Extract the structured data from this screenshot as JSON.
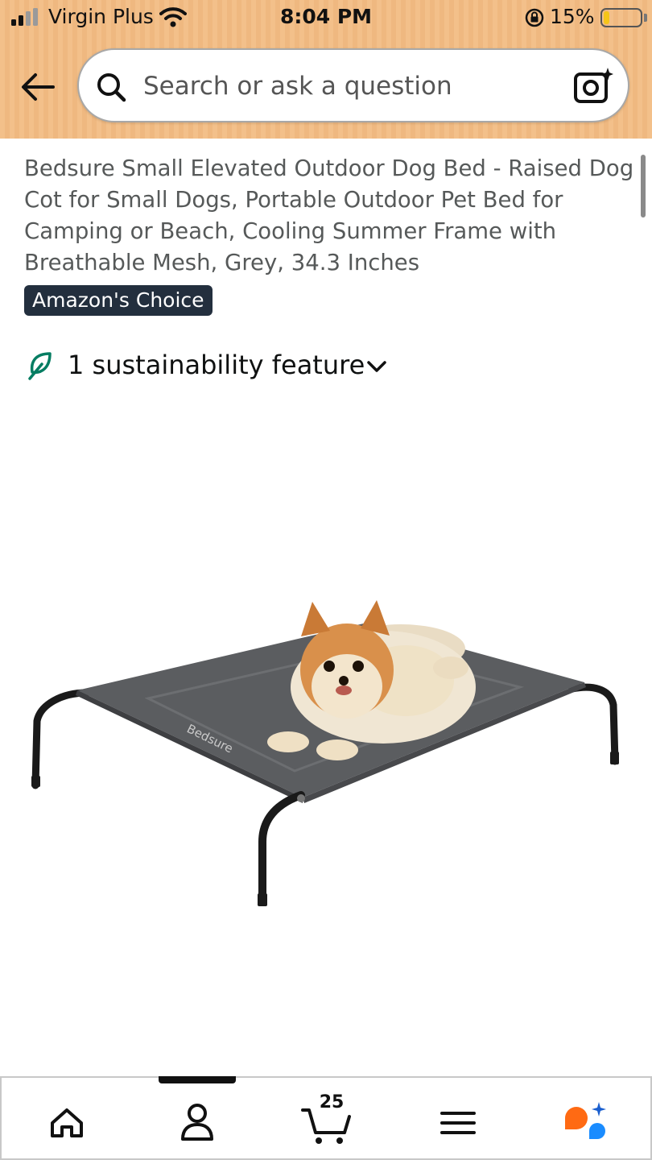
{
  "status_bar": {
    "carrier": "Virgin Plus",
    "time": "8:04 PM",
    "battery_percent": "15%",
    "battery_level": 0.15
  },
  "search": {
    "placeholder": "Search or ask a question"
  },
  "product": {
    "title": "Bedsure Small Elevated Outdoor Dog Bed - Raised Dog Cot for Small Dogs, Portable Outdoor Pet Bed for Camping or Beach, Cooling Summer Frame with Breathable Mesh, Grey, 34.3 Inches",
    "badge": "Amazon's Choice",
    "sustainability": "1 sustainability feature",
    "bed_logo_text": "Bedsure"
  },
  "bottom_nav": {
    "items": [
      "home-icon",
      "account-icon",
      "cart-icon",
      "menu-icon",
      "rufus-icon"
    ],
    "cart_count": "25"
  },
  "colors": {
    "header_bg": "#f3c08a",
    "badge_bg": "#232f3e",
    "leaf": "#067d62",
    "rufus_orange": "#ff6a13",
    "rufus_blue": "#1a8cff"
  }
}
